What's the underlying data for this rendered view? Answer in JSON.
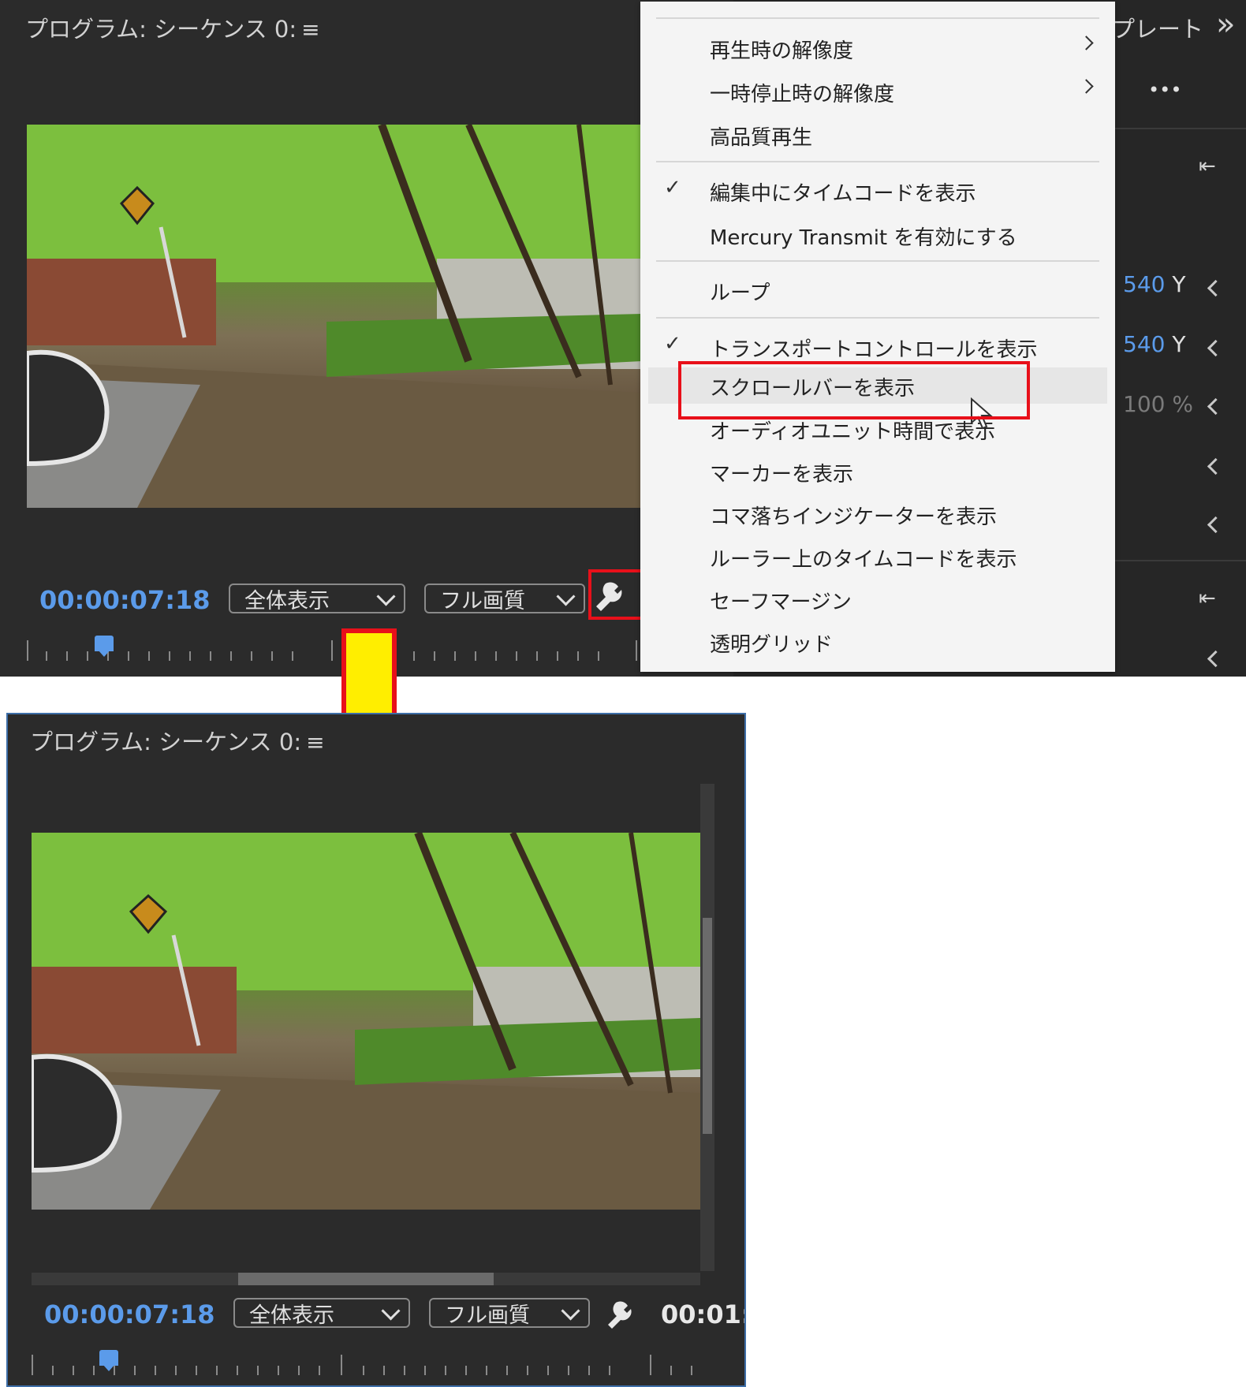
{
  "top_panel": {
    "title": "プログラム: シーケンス 0:",
    "menu_icon": "≡",
    "timecode": "00:00:07:18",
    "zoom_select": "全体表示",
    "quality_select": "フル画質",
    "wrench_icon": "wrench-icon"
  },
  "background_panel": {
    "tab_partial": "プレート",
    "overflow_glyph": "»",
    "more_glyph": "•••",
    "values": [
      {
        "num": "540",
        "axis": "Y"
      },
      {
        "num": "540",
        "axis": "Y"
      },
      {
        "num": "100 %",
        "axis": ""
      }
    ]
  },
  "menu": {
    "items": [
      {
        "label": "再生時の解像度",
        "check": "",
        "submenu": true
      },
      {
        "label": "一時停止時の解像度",
        "check": "",
        "submenu": true
      },
      {
        "label": "高品質再生",
        "check": "",
        "submenu": false
      },
      {
        "label": "編集中にタイムコードを表示",
        "check": "✓",
        "submenu": false
      },
      {
        "label": "Mercury Transmit を有効にする",
        "check": "",
        "submenu": false
      },
      {
        "label": "ループ",
        "check": "",
        "submenu": false
      },
      {
        "label": "トランスポートコントロールを表示",
        "check": "✓",
        "submenu": false
      },
      {
        "label": "スクロールバーを表示",
        "check": "",
        "submenu": false
      },
      {
        "label": "オーディオユニット時間で表示",
        "check": "",
        "submenu": false
      },
      {
        "label": "マーカーを表示",
        "check": "",
        "submenu": false
      },
      {
        "label": "コマ落ちインジケーターを表示",
        "check": "",
        "submenu": false
      },
      {
        "label": "ルーラー上のタイムコードを表示",
        "check": "",
        "submenu": false
      },
      {
        "label": "セーフマージン",
        "check": "",
        "submenu": false
      },
      {
        "label": "透明グリッド",
        "check": "",
        "submenu": false
      }
    ]
  },
  "bottom_panel": {
    "title": "プログラム: シーケンス 0:",
    "menu_icon": "≡",
    "timecode": "00:00:07:18",
    "zoom_select": "全体表示",
    "quality_select": "フル画質",
    "duration_partial": "00:01:"
  },
  "colors": {
    "timecode": "#5b9bea",
    "highlight_box": "#e8101a",
    "arrow_fill": "#ffee00",
    "arrow_stroke": "#e8101a"
  }
}
